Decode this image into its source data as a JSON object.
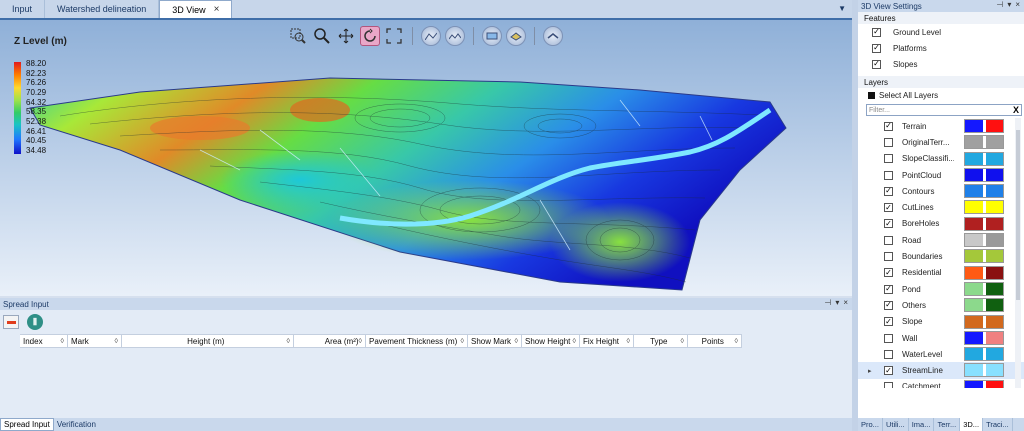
{
  "doc_tabs": [
    {
      "label": "Input"
    },
    {
      "label": "Watershed delineation"
    },
    {
      "label": "3D View",
      "close": "×"
    }
  ],
  "viewport": {
    "z_label": "Z Level (m)",
    "legend_values": [
      "88.20",
      "82.23",
      "76.26",
      "70.29",
      "64.32",
      "58.35",
      "52.38",
      "46.41",
      "40.45",
      "34.48"
    ],
    "legend_colors": [
      "#e31a1c",
      "#ff7f00",
      "#ffd92f",
      "#9be24a",
      "#33cc66",
      "#19c4c4",
      "#1f78ff",
      "#1010c8"
    ],
    "toolbar_icons": [
      "zoom-window-icon",
      "zoom-icon",
      "pan-icon",
      "rotate-icon",
      "fit-extents-icon",
      "view-front-icon",
      "view-side-icon",
      "view-top-icon",
      "view-iso-icon",
      "settings-view-icon"
    ]
  },
  "spread": {
    "title": "Spread Input",
    "columns": [
      "Index",
      "Mark",
      "Height (m)",
      "Area (m²)",
      "Pavement Thickness (m)",
      "Show Mark",
      "Show Height",
      "Fix Height",
      "Type",
      "Points"
    ],
    "pin": "📌",
    "menu": "▾",
    "close": "×"
  },
  "bottom_tabs": [
    {
      "label": "Spread Input"
    },
    {
      "label": "Verification"
    }
  ],
  "settings": {
    "title": "3D View Settings",
    "features_label": "Features",
    "features": [
      {
        "label": "Ground Level",
        "checked": true
      },
      {
        "label": "Platforms",
        "checked": true
      },
      {
        "label": "Slopes",
        "checked": true
      }
    ],
    "layers_label": "Layers",
    "select_all": "Select All Layers",
    "filter_placeholder": "Filter...",
    "filter_clear": "X",
    "layers": [
      {
        "name": "Terrain",
        "checked": true,
        "c1": "#1418ff",
        "c2": "#ff1010"
      },
      {
        "name": "OriginalTerr...",
        "checked": false,
        "c1": "#a0a0a0",
        "c2": "#a0a0a0"
      },
      {
        "name": "SlopeClassifi...",
        "checked": false,
        "c1": "#22a8e0",
        "c2": "#22a8e0"
      },
      {
        "name": "PointCloud",
        "checked": false,
        "c1": "#1010ee",
        "c2": "#1010ee"
      },
      {
        "name": "Contours",
        "checked": true,
        "c1": "#1f80e8",
        "c2": "#1f80e8"
      },
      {
        "name": "CutLines",
        "checked": true,
        "c1": "#ffff00",
        "c2": "#ffff00"
      },
      {
        "name": "BoreHoles",
        "checked": true,
        "c1": "#b02020",
        "c2": "#b02020"
      },
      {
        "name": "Road",
        "checked": false,
        "c1": "#c8c8c8",
        "c2": "#9a9a9a"
      },
      {
        "name": "Boundaries",
        "checked": false,
        "c1": "#a4c83a",
        "c2": "#a4c83a"
      },
      {
        "name": "Residential",
        "checked": true,
        "c1": "#ff5a14",
        "c2": "#8a1010"
      },
      {
        "name": "Pond",
        "checked": true,
        "c1": "#8cd98c",
        "c2": "#106010"
      },
      {
        "name": "Others",
        "checked": true,
        "c1": "#8cd98c",
        "c2": "#106010"
      },
      {
        "name": "Slope",
        "checked": true,
        "c1": "#d2691e",
        "c2": "#d2691e"
      },
      {
        "name": "Wall",
        "checked": false,
        "c1": "#1418ff",
        "c2": "#f08080"
      },
      {
        "name": "WaterLevel",
        "checked": false,
        "c1": "#22a8e0",
        "c2": "#22a8e0"
      },
      {
        "name": "StreamLine",
        "checked": true,
        "c1": "#88e0ff",
        "c2": "#88e0ff",
        "selected": true,
        "arrow": "▸"
      },
      {
        "name": "Catchment",
        "checked": false,
        "c1": "#1418ff",
        "c2": "#ff1010"
      }
    ]
  },
  "right_tabs": [
    {
      "label": "Pro..."
    },
    {
      "label": "Utili..."
    },
    {
      "label": "Ima..."
    },
    {
      "label": "Terr..."
    },
    {
      "label": "3D..."
    },
    {
      "label": "Traci..."
    }
  ]
}
